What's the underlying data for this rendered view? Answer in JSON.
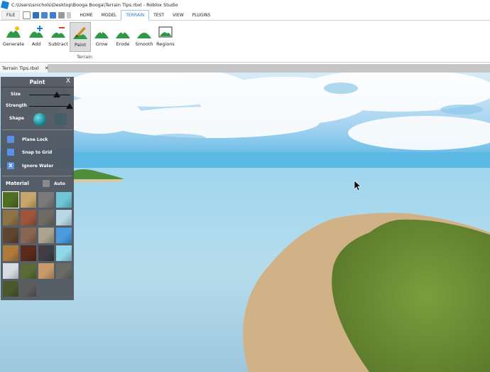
{
  "titlebar": {
    "title": "C:\\Users\\snichols\\Desktop\\Booga Booga\\Terrain Tips.rbxl - Roblox Studio",
    "logo_color": "#1a7fd6"
  },
  "menu": {
    "file": "FILE",
    "tabs": [
      "HOME",
      "MODEL",
      "TERRAIN",
      "TEST",
      "VIEW",
      "PLUGINS"
    ],
    "active_tab": "TERRAIN"
  },
  "ribbon": {
    "tools": [
      {
        "label": "Generate",
        "icon": "generate-icon"
      },
      {
        "label": "Add",
        "icon": "add-terrain-icon"
      },
      {
        "label": "Subtract",
        "icon": "subtract-terrain-icon"
      },
      {
        "label": "Paint",
        "icon": "paint-terrain-icon"
      },
      {
        "label": "Grow",
        "icon": "grow-terrain-icon"
      },
      {
        "label": "Erode",
        "icon": "erode-terrain-icon"
      },
      {
        "label": "Smooth",
        "icon": "smooth-terrain-icon"
      },
      {
        "label": "Regions",
        "icon": "regions-icon"
      }
    ],
    "selected_tool": "Paint",
    "group_label": "Terrain"
  },
  "document": {
    "tab_title": "Terrain Tips.rbxl",
    "close_glyph": "✕"
  },
  "paint_panel": {
    "title": "Paint",
    "close_glyph": "X",
    "size_label": "Size",
    "size_value": 0.6,
    "strength_label": "Strength",
    "strength_value": 1.0,
    "shape_label": "Shape",
    "plane_lock_label": "Plane Lock",
    "plane_lock_checked": false,
    "snap_to_grid_label": "Snap to Grid",
    "snap_to_grid_checked": false,
    "ignore_water_label": "Ignore Water",
    "ignore_water_checked": true,
    "ignore_water_mark": "X",
    "material_label": "Material",
    "auto_label": "Auto",
    "materials": [
      {
        "name": "grass",
        "color": "#4f6f22"
      },
      {
        "name": "sand",
        "color": "#c7a66b"
      },
      {
        "name": "rock",
        "color": "#7a7a7a"
      },
      {
        "name": "glacier",
        "color": "#6ec5d6"
      },
      {
        "name": "ground",
        "color": "#8c7446"
      },
      {
        "name": "brick",
        "color": "#a0553a"
      },
      {
        "name": "slate",
        "color": "#6e6b63"
      },
      {
        "name": "ice",
        "color": "#b8d7e6"
      },
      {
        "name": "mud",
        "color": "#5e4630"
      },
      {
        "name": "cobblestone",
        "color": "#8a6552"
      },
      {
        "name": "limestone",
        "color": "#a9a38f"
      },
      {
        "name": "water",
        "color": "#4a9be0"
      },
      {
        "name": "wood-planks",
        "color": "#b07a3a"
      },
      {
        "name": "cracked-lava",
        "color": "#5a2a1a"
      },
      {
        "name": "basalt",
        "color": "#3e3e44"
      },
      {
        "name": "salt",
        "color": "#8fd8ea"
      },
      {
        "name": "snow",
        "color": "#d6dde2"
      },
      {
        "name": "leafy-grass",
        "color": "#5a6b36"
      },
      {
        "name": "sandstone",
        "color": "#c89a6a"
      },
      {
        "name": "pavement",
        "color": "#6a6a66"
      },
      {
        "name": "asphalt",
        "color": "#4a5a2c"
      },
      {
        "name": "concrete",
        "color": "#5c5c5c"
      }
    ],
    "selected_material": "grass"
  },
  "colors": {
    "panel_bg": "#4e545c",
    "accent": "#2a7ad6",
    "sky": "#bfe0f5",
    "water": "#a9d4ea",
    "sand": "#cfae84",
    "grass": "#6e8f35"
  }
}
